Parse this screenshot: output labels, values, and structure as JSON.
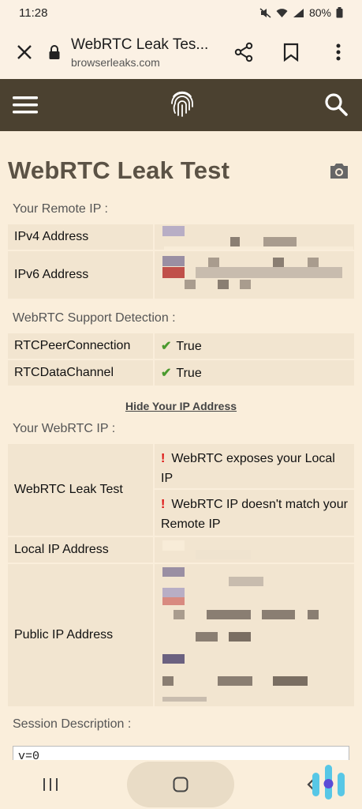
{
  "status_bar": {
    "time": "11:28",
    "battery": "80%"
  },
  "browser": {
    "title": "WebRTC Leak Tes...",
    "url": "browserleaks.com"
  },
  "page": {
    "title": "WebRTC Leak Test"
  },
  "remote_ip": {
    "label": "Your Remote IP :",
    "rows": [
      {
        "key": "IPv4 Address"
      },
      {
        "key": "IPv6 Address"
      }
    ]
  },
  "support": {
    "label": "WebRTC Support Detection :",
    "rows": [
      {
        "key": "RTCPeerConnection",
        "value": "True"
      },
      {
        "key": "RTCDataChannel",
        "value": "True"
      }
    ]
  },
  "hide_link": "Hide Your IP Address",
  "webrtc_ip": {
    "label": "Your WebRTC IP :",
    "leak_key": "WebRTC Leak Test",
    "leak_msgs": [
      "WebRTC exposes your Local IP",
      "WebRTC IP doesn't match your Remote IP"
    ],
    "local_key": "Local IP Address",
    "public_key": "Public IP Address"
  },
  "session": {
    "label": "Session Description :",
    "first_line": "v=0"
  },
  "colors": {
    "header_bg": "#4b4130",
    "page_bg": "#faeedb",
    "cell_bg": "#f2e5d0",
    "check": "#4a9a2e",
    "warning": "#dd1111"
  }
}
